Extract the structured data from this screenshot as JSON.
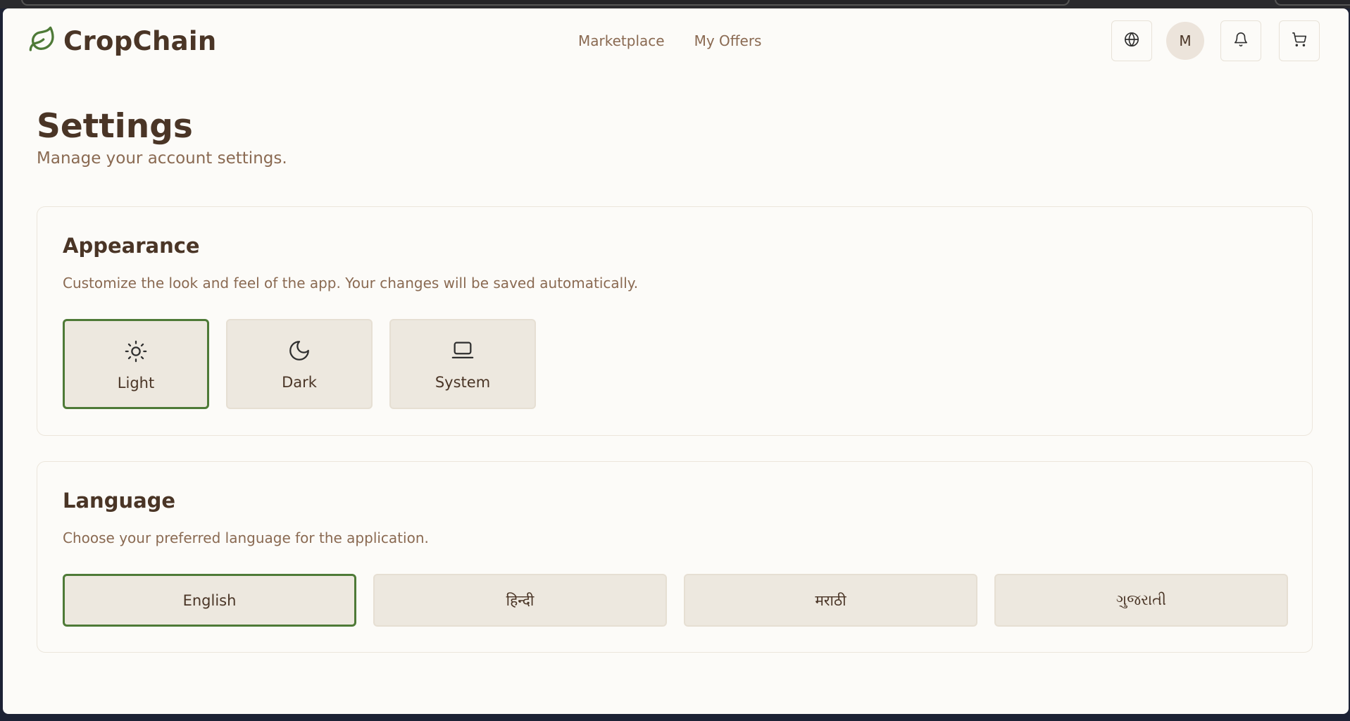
{
  "app": {
    "name": "CropChain"
  },
  "nav": {
    "items": [
      {
        "label": "Marketplace"
      },
      {
        "label": "My Offers"
      }
    ]
  },
  "header": {
    "avatar_initial": "M",
    "icons": [
      "globe-icon",
      "bell-icon",
      "cart-icon"
    ]
  },
  "page": {
    "title": "Settings",
    "subtitle": "Manage your account settings."
  },
  "appearance": {
    "title": "Appearance",
    "description": "Customize the look and feel of the app. Your changes will be saved automatically.",
    "options": [
      {
        "label": "Light",
        "icon": "sun-icon",
        "selected": true
      },
      {
        "label": "Dark",
        "icon": "moon-icon",
        "selected": false
      },
      {
        "label": "System",
        "icon": "laptop-icon",
        "selected": false
      }
    ]
  },
  "language": {
    "title": "Language",
    "description": "Choose your preferred language for the application.",
    "options": [
      {
        "label": "English",
        "selected": true
      },
      {
        "label": "हिन्दी",
        "selected": false
      },
      {
        "label": "मराठी",
        "selected": false
      },
      {
        "label": "ગુજરાતી",
        "selected": false
      }
    ]
  },
  "colors": {
    "accent": "#4e7a37",
    "text": "#4a3526",
    "muted": "#8a6a52",
    "background": "#fcfbf8"
  }
}
